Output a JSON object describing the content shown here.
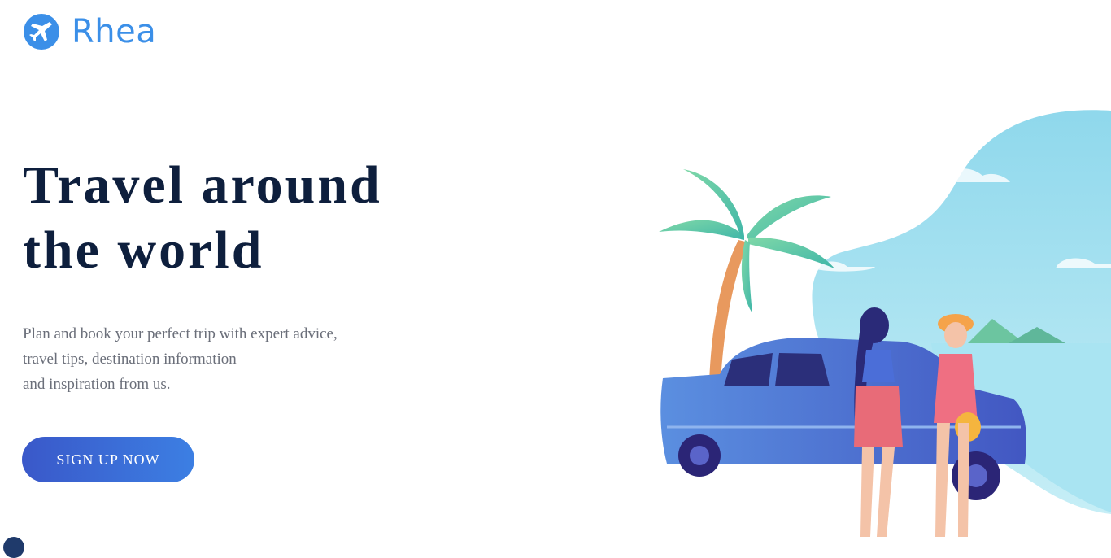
{
  "brand": {
    "name": "Rhea",
    "color": "#3b8fe8",
    "icon": "airplane-icon"
  },
  "hero": {
    "title_line1": "Travel around",
    "title_line2": "the world",
    "description_line1": "Plan and book your perfect trip with expert advice,",
    "description_line2": "travel tips, destination information",
    "description_line3": "and inspiration from us.",
    "cta_label": "SIGN UP NOW"
  },
  "colors": {
    "title": "#0e1f3d",
    "text": "#6b6f7a",
    "cta_start": "#3a58c9",
    "cta_end": "#3c7fe3"
  },
  "illustration": {
    "icon": "beach-car-illustration"
  }
}
